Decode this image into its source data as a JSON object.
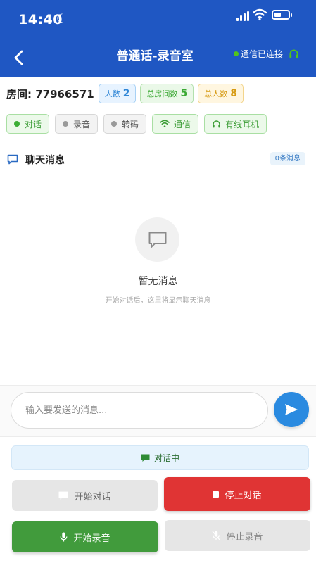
{
  "status_bar": {
    "time": "14:40"
  },
  "nav": {
    "title": "普通话-录音室",
    "connection_status": "通信已连接"
  },
  "room": {
    "label": "房间: 77966571",
    "badges": [
      {
        "label": "人数",
        "value": "2"
      },
      {
        "label": "总房间数",
        "value": "5"
      },
      {
        "label": "总人数",
        "value": "8"
      }
    ]
  },
  "chips": [
    {
      "label": "对话"
    },
    {
      "label": "录音"
    },
    {
      "label": "转码"
    },
    {
      "label": "通信"
    },
    {
      "label": "有线耳机"
    }
  ],
  "chat": {
    "title": "聊天消息",
    "count": "0条消息",
    "empty_title": "暂无消息",
    "empty_subtitle": "开始对话后，这里将显示聊天消息"
  },
  "composer": {
    "placeholder": "输入要发送的消息..."
  },
  "controls": {
    "status": "对话中",
    "start_talk": "开始对话",
    "stop_talk": "停止对话",
    "start_record": "开始录音",
    "stop_record": "停止录音"
  },
  "colors": {
    "header": "#1f57c3",
    "connected": "#52c41a",
    "stop_talk": "#e03434",
    "start_record": "#419b3c",
    "send": "#2a8ae0"
  }
}
